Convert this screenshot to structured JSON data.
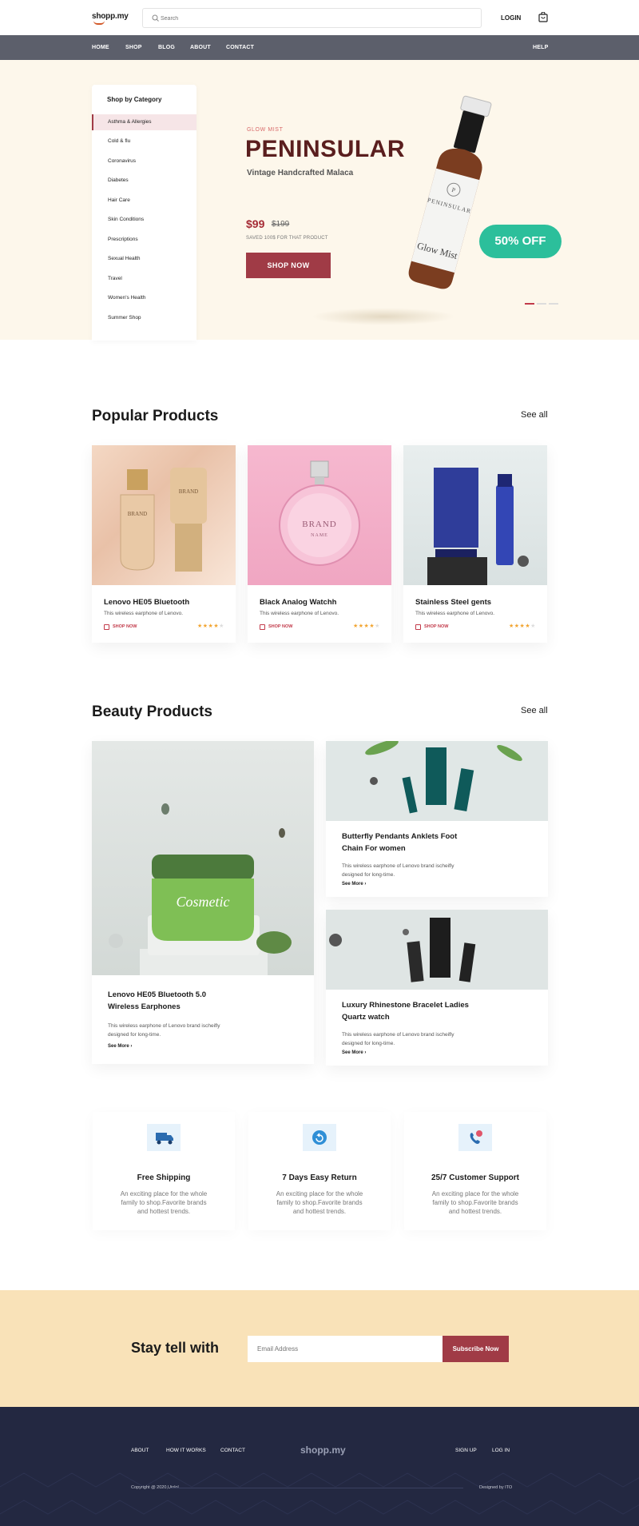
{
  "header": {
    "logo": "shopp.my",
    "search_placeholder": "Search",
    "login": "LOGIN"
  },
  "nav": {
    "items": [
      "HOME",
      "SHOP",
      "BLOG",
      "ABOUT",
      "CONTACT"
    ],
    "help": "HELP"
  },
  "categories": {
    "title": "Shop by Category",
    "items": [
      "Asthma & Allergies",
      "Cold & flu",
      "Coronavirus",
      "Diabetes",
      "Hair Care",
      "Skin Conditions",
      "Prescriptions",
      "Sexual Health",
      "Travel",
      "Women's Health",
      "Summer Shop"
    ]
  },
  "hero": {
    "eyebrow": "GLOW MIST",
    "title": "PENINSULAR",
    "subtitle": "Vintage Handcrafted Malaca",
    "price": "$99",
    "old_price": "$199",
    "saved": "SAVED 100$ FOR THAT PRODUCT",
    "cta": "SHOP NOW",
    "badge": "50% OFF",
    "bottle_brand": "PENINSULAR",
    "bottle_name": "Glow Mist",
    "carousel_active_index": 0,
    "carousel_count": 3
  },
  "popular": {
    "title": "Popular Products",
    "see_all": "See all",
    "products": [
      {
        "name": "Lenovo HE05 Bluetooth",
        "desc": "This wireless earphone of Lenovo.",
        "cta": "SHOP NOW",
        "rating": 4
      },
      {
        "name": "Black Analog Watchh",
        "desc": "This wireless earphone of Lenovo.",
        "cta": "SHOP NOW",
        "rating": 4
      },
      {
        "name": "Stainless Steel gents",
        "desc": "This wireless earphone of Lenovo.",
        "cta": "SHOP NOW",
        "rating": 4
      }
    ],
    "image_text": {
      "brand": "BRAND",
      "name": "NAME"
    }
  },
  "beauty": {
    "title": "Beauty Products",
    "see_all": "See all",
    "big": {
      "name_line1": "Lenovo HE05 Bluetooth 5.0",
      "name_line2": "Wireless Earphones",
      "desc_line1": "This wireless earphone of Lenovo brand ischeifly",
      "desc_line2": "designed for long-time.",
      "more": "See More",
      "jar_label": "Cosmetic"
    },
    "small": [
      {
        "name_line1": "Butterfly Pendants Anklets Foot",
        "name_line2": "Chain For women",
        "desc_line1": "This wireless earphone of Lenovo brand ischeifly",
        "desc_line2": "designed for long-time.",
        "more": "See More"
      },
      {
        "name_line1": "Luxury Rhinestone Bracelet Ladies",
        "name_line2": "Quartz watch",
        "desc_line1": "This wireless earphone of Lenovo brand ischeifly",
        "desc_line2": "designed for long-time.",
        "more": "See More"
      }
    ]
  },
  "features": [
    {
      "title": "Free Shipping",
      "desc_line1": "An exciting place for the whole",
      "desc_line2": "family to shop.Favorite brands",
      "desc_line3": "and hottest trends.",
      "icon": "truck-icon"
    },
    {
      "title": "7 Days Easy Return",
      "desc_line1": "An exciting place for the whole",
      "desc_line2": "family to shop.Favorite brands",
      "desc_line3": "and hottest trends.",
      "icon": "return-icon"
    },
    {
      "title": "25/7 Customer Support",
      "desc_line1": "An exciting place for the whole",
      "desc_line2": "family to shop.Favorite brands",
      "desc_line3": "and hottest trends.",
      "icon": "phone-support-icon"
    }
  ],
  "subscribe": {
    "title": "Stay tell with",
    "placeholder": "Email Address",
    "button": "Subscribe Now"
  },
  "footer": {
    "links_left": [
      "ABOUT",
      "HOW IT WORKS",
      "CONTACT"
    ],
    "logo": "shopp.my",
    "links_right": [
      "SIGN UP",
      "LOG IN"
    ],
    "copyright": "Copyright @ 2020,Uiolol",
    "designed_by": "Designed by ITO"
  },
  "colors": {
    "accent": "#a03b46",
    "nav_bg": "#5c5f6b",
    "hero_bg": "#fdf7eb",
    "badge": "#2cbf9b",
    "subscribe_bg": "#f9e2b8",
    "footer_bg": "#232841"
  }
}
